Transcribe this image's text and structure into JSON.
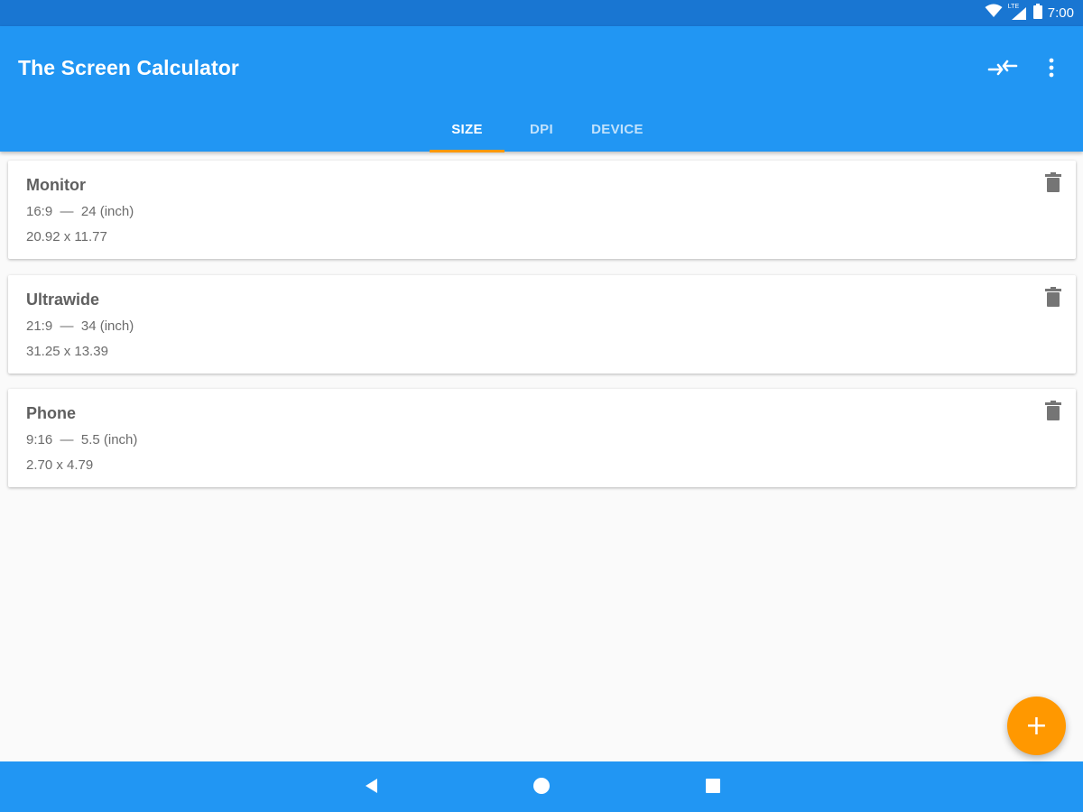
{
  "status_bar": {
    "time": "7:00",
    "icons": [
      "wifi-icon",
      "signal-icon",
      "battery-icon"
    ],
    "network_label": "LTE"
  },
  "app_bar": {
    "title": "The Screen Calculator",
    "actions": [
      "swap-icon",
      "more-vert-icon"
    ]
  },
  "tabs": [
    {
      "label": "SIZE",
      "active": true
    },
    {
      "label": "DPI",
      "active": false
    },
    {
      "label": "DEVICE",
      "active": false
    }
  ],
  "cards": [
    {
      "title": "Monitor",
      "ratio_size": "16:9  —  24 (inch)",
      "dimensions": "20.92 x 11.77"
    },
    {
      "title": "Ultrawide",
      "ratio_size": "21:9  —  34 (inch)",
      "dimensions": "31.25 x 13.39"
    },
    {
      "title": "Phone",
      "ratio_size": "9:16  —  5.5 (inch)",
      "dimensions": "2.70 x 4.79"
    }
  ],
  "fab": {
    "icon": "plus-icon",
    "label": "+"
  },
  "nav_bar": {
    "buttons": [
      "back-icon",
      "home-icon",
      "recents-icon"
    ]
  },
  "colors": {
    "status_bar": "#1976d2",
    "primary": "#2196f3",
    "accent": "#ff9800",
    "background": "#fafafa",
    "card": "#ffffff",
    "text_primary": "#5f5f5f",
    "text_secondary": "#6b6b6b",
    "icon_grey": "#757575"
  }
}
